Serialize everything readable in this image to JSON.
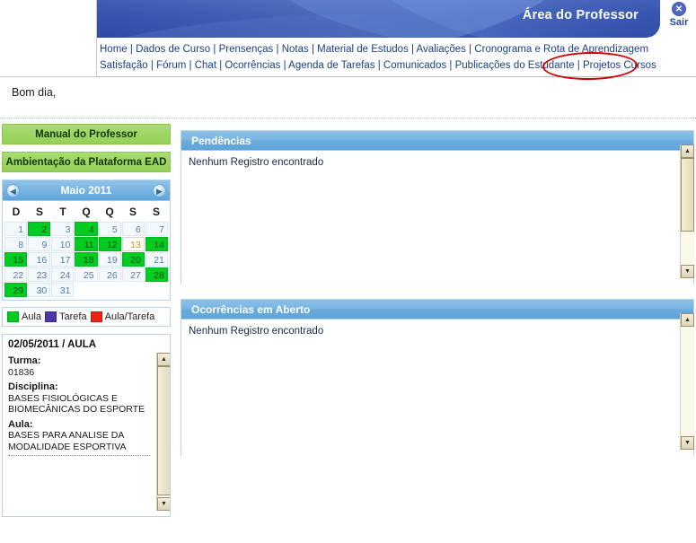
{
  "header": {
    "title": "Área do Professor",
    "logout_label": "Sair",
    "logout_icon": "close-circle-icon",
    "nav_rows": [
      [
        "Home",
        "Dados de Curso",
        "Prensenças",
        "Notas",
        "Material de Estudos",
        "Avaliações",
        "Cronograma e Rota de Aprendizagem"
      ],
      [
        "Satisfação",
        "Fórum",
        "Chat",
        "Ocorrências",
        "Agenda de Tarefas",
        "Comunicados",
        "Publicações do Estudante",
        "Projetos Cursos"
      ]
    ],
    "separator": "|"
  },
  "greeting": "Bom dia,",
  "annotation": {
    "color": "#d40000",
    "target": "Projetos Cursos"
  },
  "sidebar": {
    "buttons": [
      {
        "label": "Manual do Professor",
        "name": "manual-do-professor-button"
      },
      {
        "label": "Ambientação da Plataforma EAD",
        "name": "ambientacao-plataforma-ead-button"
      }
    ],
    "calendar": {
      "title": "Maio 2011",
      "prev_icon": "chevron-left-icon",
      "next_icon": "chevron-right-icon",
      "weekdays": [
        "D",
        "S",
        "T",
        "Q",
        "Q",
        "S",
        "S"
      ],
      "lead_blank": 0,
      "days": [
        {
          "n": 1,
          "type": "none"
        },
        {
          "n": 2,
          "type": "aula"
        },
        {
          "n": 3,
          "type": "none"
        },
        {
          "n": 4,
          "type": "aula"
        },
        {
          "n": 5,
          "type": "none"
        },
        {
          "n": 6,
          "type": "none"
        },
        {
          "n": 7,
          "type": "none"
        },
        {
          "n": 8,
          "type": "none"
        },
        {
          "n": 9,
          "type": "none"
        },
        {
          "n": 10,
          "type": "none"
        },
        {
          "n": 11,
          "type": "aula"
        },
        {
          "n": 12,
          "type": "aula"
        },
        {
          "n": 13,
          "type": "today"
        },
        {
          "n": 14,
          "type": "aula"
        },
        {
          "n": 15,
          "type": "aula"
        },
        {
          "n": 16,
          "type": "none"
        },
        {
          "n": 17,
          "type": "none"
        },
        {
          "n": 18,
          "type": "aula"
        },
        {
          "n": 19,
          "type": "none"
        },
        {
          "n": 20,
          "type": "aula"
        },
        {
          "n": 21,
          "type": "none"
        },
        {
          "n": 22,
          "type": "none"
        },
        {
          "n": 23,
          "type": "none"
        },
        {
          "n": 24,
          "type": "none"
        },
        {
          "n": 25,
          "type": "none"
        },
        {
          "n": 26,
          "type": "none"
        },
        {
          "n": 27,
          "type": "none"
        },
        {
          "n": 28,
          "type": "aula"
        },
        {
          "n": 29,
          "type": "aula"
        },
        {
          "n": 30,
          "type": "none"
        },
        {
          "n": 31,
          "type": "none"
        }
      ]
    },
    "legend": [
      {
        "label": "Aula",
        "color": "#00cc22",
        "cls": "aula"
      },
      {
        "label": "Tarefa",
        "color": "#4b37a8",
        "cls": "tarefa"
      },
      {
        "label": "Aula/Tarefa",
        "color": "#ee2211",
        "cls": "ambos"
      }
    ],
    "detail": {
      "title": "02/05/2011 / AULA",
      "fields": [
        {
          "label": "Turma:",
          "value": "01836"
        },
        {
          "label": "Disciplina:",
          "value": "BASES FISIOLÓGICAS E BIOMECÂNICAS DO ESPORTE"
        },
        {
          "label": "Aula:",
          "value": "BASES PARA ANALISE DA MODALIDADE ESPORTIVA"
        }
      ]
    }
  },
  "panels": [
    {
      "title": "Pendências",
      "body": "Nenhum Registro encontrado"
    },
    {
      "title": "Ocorrências em Aberto",
      "body": "Nenhum Registro encontrado"
    }
  ],
  "scroll": {
    "up_icon": "triangle-up-icon",
    "down_icon": "triangle-down-icon"
  },
  "colors": {
    "banner_blue": "#2a44a0",
    "panel_header_blue": "#6aaadd",
    "green_button": "#9ed563",
    "event_green": "#00cc22",
    "annotation_red": "#d40000",
    "link_blue": "#1b3f85"
  }
}
